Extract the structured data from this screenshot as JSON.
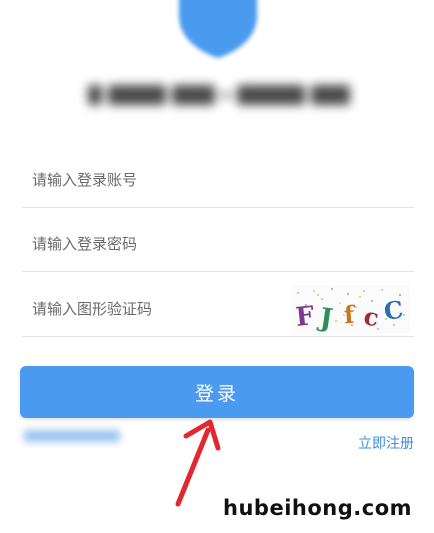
{
  "header": {
    "logo_icon": "shield-icon"
  },
  "form": {
    "account_placeholder": "请输入登录账号",
    "password_placeholder": "请输入登录密码",
    "captcha_placeholder": "请输入图形验证码",
    "captcha_chars": [
      "F",
      "J",
      "f",
      "c",
      "C"
    ],
    "login_label": "登录",
    "register_label": "立即注册"
  },
  "colors": {
    "primary": "#4a9bef",
    "link": "#3a8ee6",
    "arrow": "#e0282e"
  },
  "watermark": {
    "text": "hubeihong.com"
  }
}
